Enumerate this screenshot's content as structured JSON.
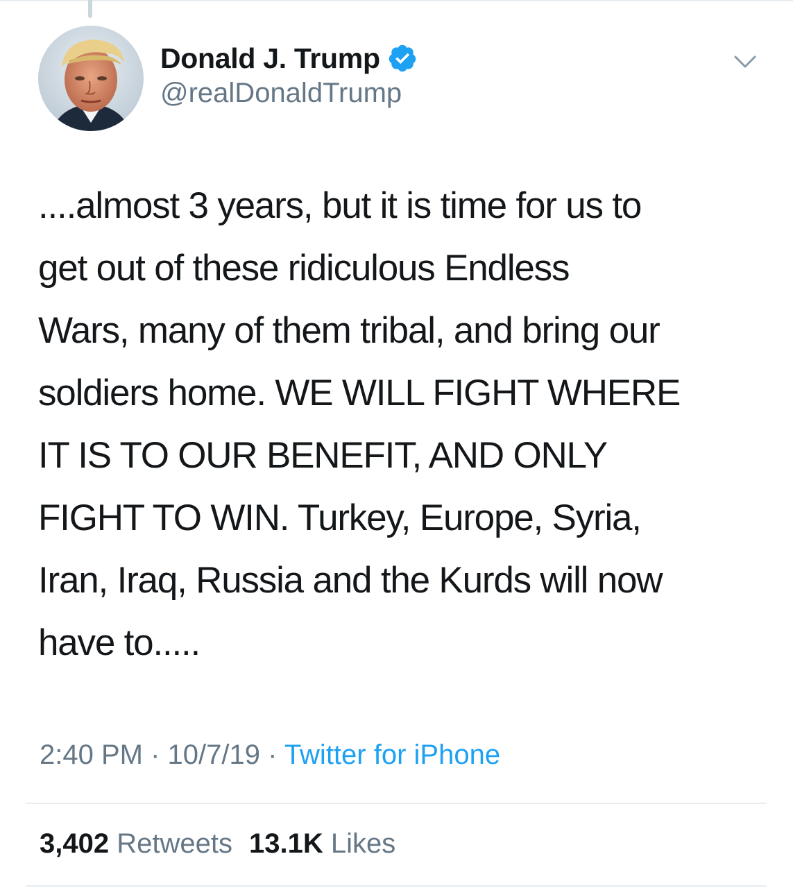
{
  "author": {
    "display_name": "Donald J. Trump",
    "handle": "@realDonaldTrump",
    "verified": true
  },
  "tweet": {
    "lines": [
      "....almost 3 years, but it is time for us to",
      "get out of these ridiculous Endless",
      "Wars, many of them tribal, and bring our",
      "soldiers home. WE WILL FIGHT WHERE",
      "IT IS TO OUR BENEFIT, AND ONLY",
      "FIGHT TO WIN. Turkey, Europe, Syria,",
      "Iran, Iraq, Russia and the Kurds will now",
      "have to....."
    ]
  },
  "meta": {
    "time": "2:40 PM",
    "separator1": " · ",
    "date": "10/7/19",
    "separator2": " · ",
    "source": "Twitter for iPhone"
  },
  "stats": {
    "retweets_count": "3,402",
    "retweets_label": " Retweets",
    "likes_count": "13.1K",
    "likes_label": " Likes"
  },
  "colors": {
    "link_blue": "#1da1f2",
    "muted_gray": "#657786",
    "text": "#14171a",
    "divider": "#e6ecf0"
  },
  "icons": {
    "verified": "verified-badge-icon",
    "caret": "chevron-down-icon"
  }
}
